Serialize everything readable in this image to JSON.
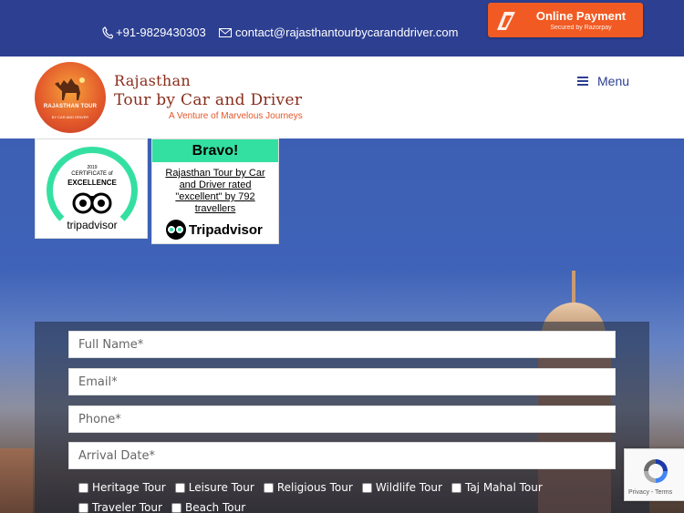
{
  "topbar": {
    "phone": "+91-9829430303",
    "email": "contact@rajasthantourbycaranddriver.com",
    "payment_title": "Online Payment",
    "payment_sub": "Secured by Razorpay"
  },
  "header": {
    "logo_ring_text": "RAJASTHAN TOUR",
    "logo_ring_sub": "BY CAR AND DRIVER",
    "brand_line1": "Rajasthan",
    "brand_line2": "Tour by Car and Driver",
    "tagline": "A Venture of Marvelous Journeys",
    "menu_label": "Menu"
  },
  "badges": {
    "coe_year": "2019",
    "coe_line1": "CERTIFICATE of",
    "coe_line2": "EXCELLENCE",
    "coe_brand": "tripadvisor",
    "bravo_title": "Bravo!",
    "bravo_text": "Rajasthan Tour by Car and Driver rated \"excellent\" by 792 travellers",
    "bravo_brand": "Tripadvisor"
  },
  "form": {
    "full_name_placeholder": "Full Name*",
    "email_placeholder": "Email*",
    "phone_placeholder": "Phone*",
    "arrival_placeholder": "Arrival Date*",
    "tour_types": [
      "Heritage Tour",
      "Leisure Tour",
      "Religious Tour",
      "Wildlife Tour",
      "Taj Mahal Tour",
      "Traveler Tour",
      "Beach Tour"
    ]
  },
  "recaptcha": {
    "links": "Privacy - Terms"
  },
  "colors": {
    "topbar": "#2c3f91",
    "payment_button": "#f15a22",
    "tripadvisor_green": "#34e0a1",
    "brand_red": "#8a2d1c"
  }
}
